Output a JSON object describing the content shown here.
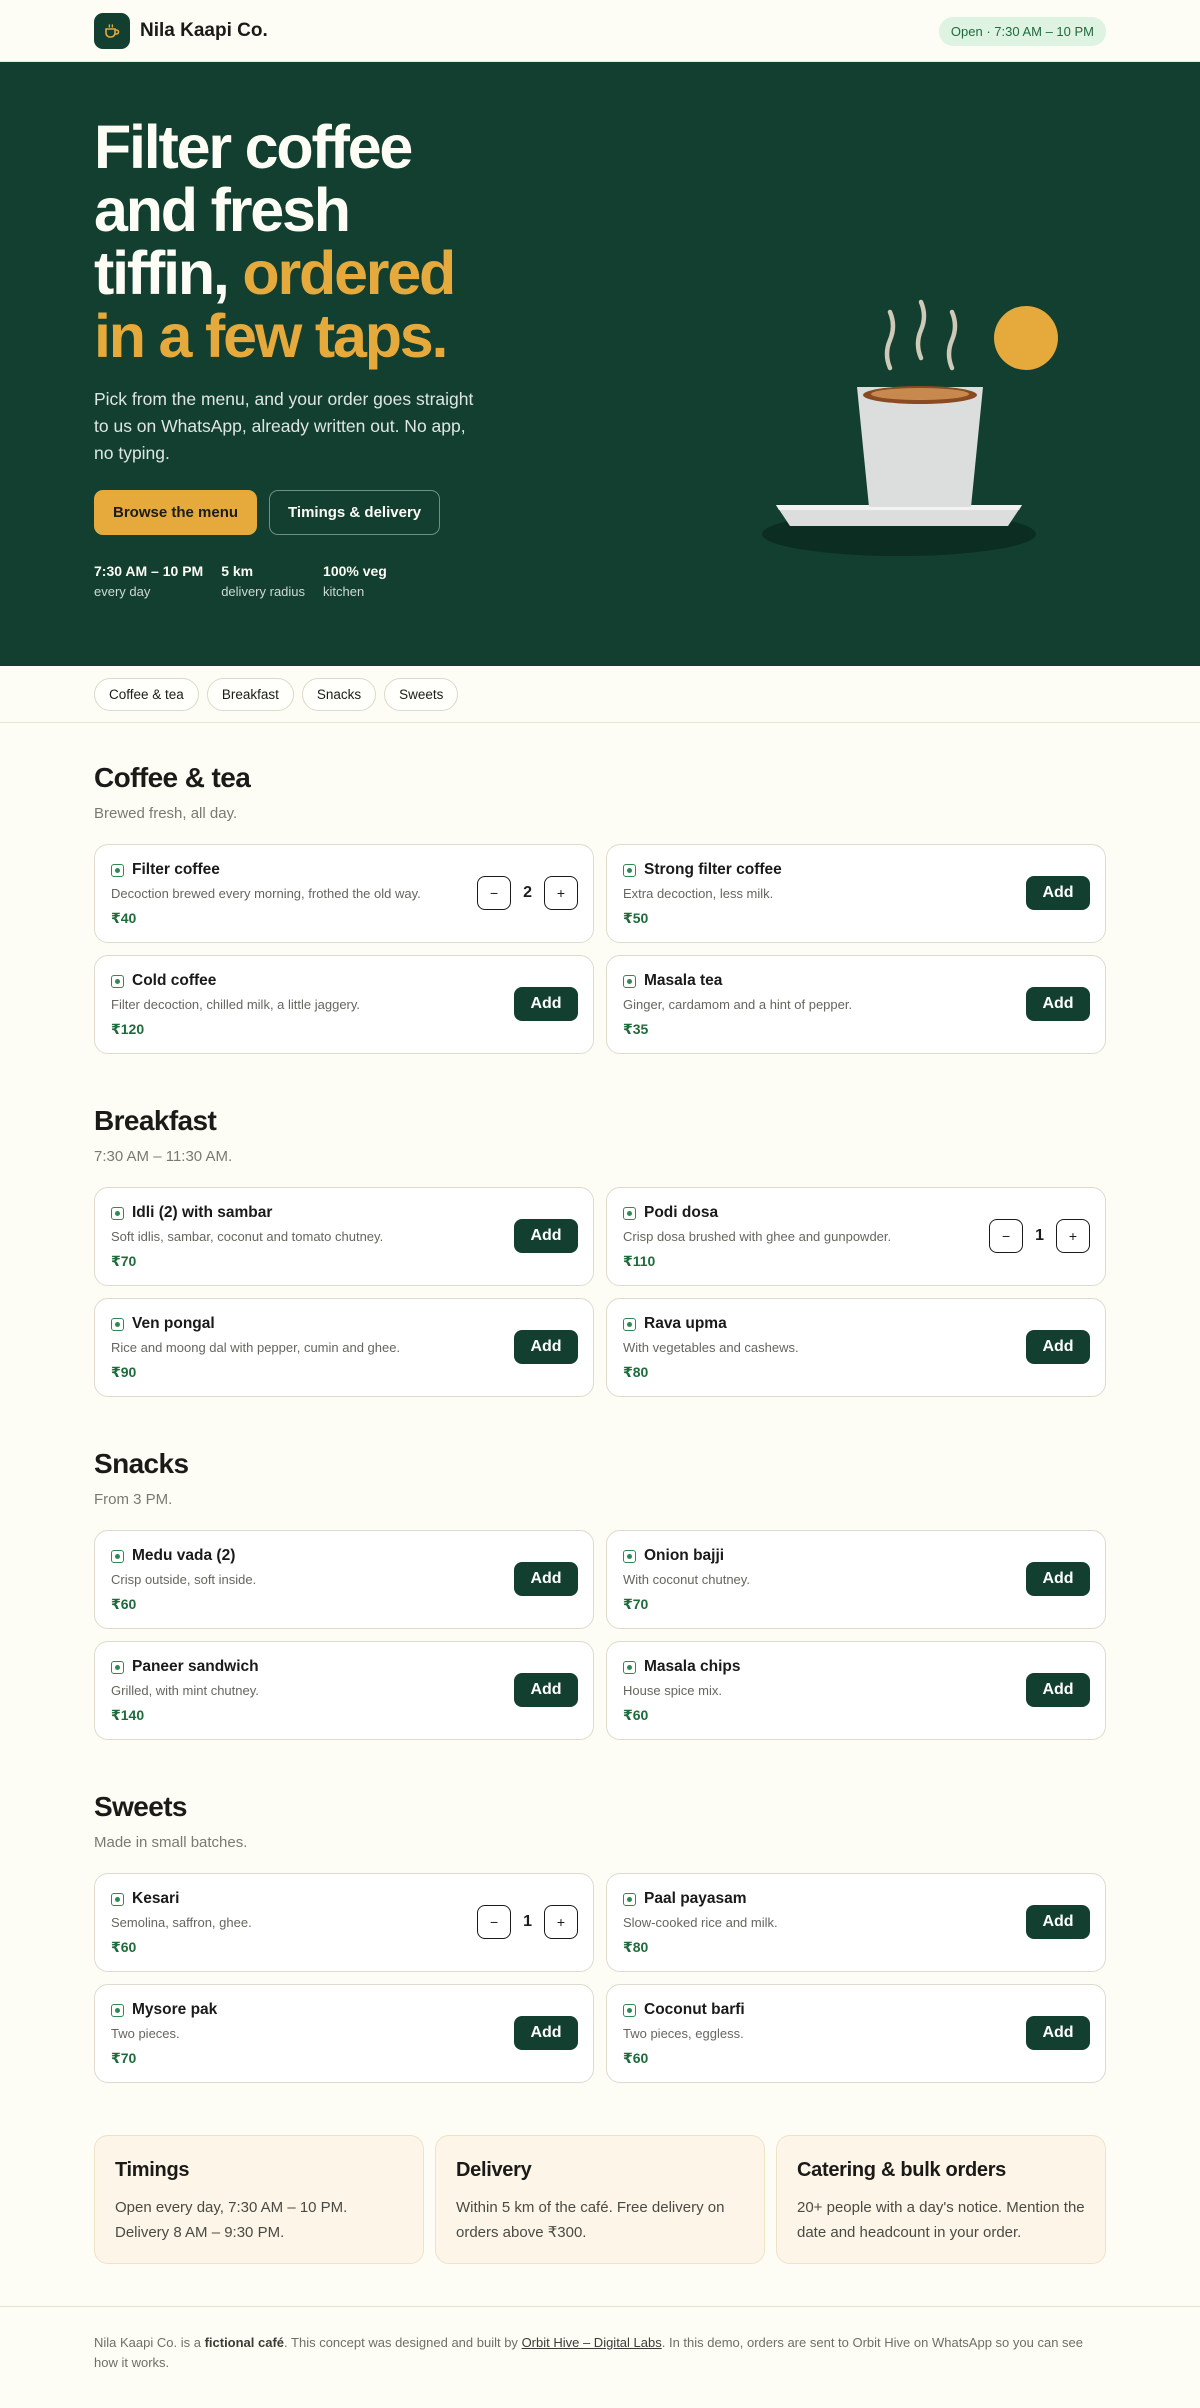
{
  "header": {
    "brand_name": "Nila Kaapi Co.",
    "logo_icon": "coffee-cup-icon",
    "status": "Open · 7:30 AM – 10 PM"
  },
  "hero": {
    "title_line1": "Filter coffee",
    "title_line2": "and fresh",
    "title_line3_plain": "tiffin, ",
    "title_line3_accent": "ordered",
    "title_line4_accent": "in a few taps.",
    "subtitle": "Pick from the menu, and your order goes straight to us on WhatsApp, already written out. No app, no typing.",
    "primary_button": "Browse the menu",
    "secondary_button": "Timings & delivery",
    "stats": [
      {
        "value": "7:30 AM – 10 PM",
        "label": "every day"
      },
      {
        "value": "5 km",
        "label": "delivery radius"
      },
      {
        "value": "100% veg",
        "label": "kitchen"
      }
    ]
  },
  "categories": [
    "Coffee & tea",
    "Breakfast",
    "Snacks",
    "Sweets"
  ],
  "colors": {
    "brand_green": "#123f30",
    "accent_gold": "#e6a93c",
    "price_green": "#1f6b3c"
  },
  "sections": [
    {
      "title": "Coffee & tea",
      "subtitle": "Brewed fresh, all day.",
      "items": [
        {
          "name": "Filter coffee",
          "desc": "Decoction brewed every morning, frothed the old way.",
          "price": "₹40",
          "qty": "2",
          "action": ""
        },
        {
          "name": "Strong filter coffee",
          "desc": "Extra decoction, less milk.",
          "price": "₹50",
          "qty": "",
          "action": "Add"
        },
        {
          "name": "Cold coffee",
          "desc": "Filter decoction, chilled milk, a little jaggery.",
          "price": "₹120",
          "qty": "",
          "action": "Add"
        },
        {
          "name": "Masala tea",
          "desc": "Ginger, cardamom and a hint of pepper.",
          "price": "₹35",
          "qty": "",
          "action": "Add"
        }
      ]
    },
    {
      "title": "Breakfast",
      "subtitle": "7:30 AM – 11:30 AM.",
      "items": [
        {
          "name": "Idli (2) with sambar",
          "desc": "Soft idlis, sambar, coconut and tomato chutney.",
          "price": "₹70",
          "qty": "",
          "action": "Add"
        },
        {
          "name": "Podi dosa",
          "desc": "Crisp dosa brushed with ghee and gunpowder.",
          "price": "₹110",
          "qty": "1",
          "action": ""
        },
        {
          "name": "Ven pongal",
          "desc": "Rice and moong dal with pepper, cumin and ghee.",
          "price": "₹90",
          "qty": "",
          "action": "Add"
        },
        {
          "name": "Rava upma",
          "desc": "With vegetables and cashews.",
          "price": "₹80",
          "qty": "",
          "action": "Add"
        }
      ]
    },
    {
      "title": "Snacks",
      "subtitle": "From 3 PM.",
      "items": [
        {
          "name": "Medu vada (2)",
          "desc": "Crisp outside, soft inside.",
          "price": "₹60",
          "qty": "",
          "action": "Add"
        },
        {
          "name": "Onion bajji",
          "desc": "With coconut chutney.",
          "price": "₹70",
          "qty": "",
          "action": "Add"
        },
        {
          "name": "Paneer sandwich",
          "desc": "Grilled, with mint chutney.",
          "price": "₹140",
          "qty": "",
          "action": "Add"
        },
        {
          "name": "Masala chips",
          "desc": "House spice mix.",
          "price": "₹60",
          "qty": "",
          "action": "Add"
        }
      ]
    },
    {
      "title": "Sweets",
      "subtitle": "Made in small batches.",
      "items": [
        {
          "name": "Kesari",
          "desc": "Semolina, saffron, ghee.",
          "price": "₹60",
          "qty": "1",
          "action": ""
        },
        {
          "name": "Paal payasam",
          "desc": "Slow-cooked rice and milk.",
          "price": "₹80",
          "qty": "",
          "action": "Add"
        },
        {
          "name": "Mysore pak",
          "desc": "Two pieces.",
          "price": "₹70",
          "qty": "",
          "action": "Add"
        },
        {
          "name": "Coconut barfi",
          "desc": "Two pieces, eggless.",
          "price": "₹60",
          "qty": "",
          "action": "Add"
        }
      ]
    }
  ],
  "stepper": {
    "minus": "−",
    "plus": "+"
  },
  "info_cards": [
    {
      "title": "Timings",
      "body": "Open every day, 7:30 AM – 10 PM. Delivery 8 AM – 9:30 PM."
    },
    {
      "title": "Delivery",
      "body": "Within 5 km of the café. Free delivery on orders above ₹300."
    },
    {
      "title": "Catering & bulk orders",
      "body": "20+ people with a day's notice. Mention the date and headcount in your order."
    }
  ],
  "footer": {
    "t1": "Nila Kaapi Co. is a ",
    "bold": "fictional café",
    "t2": ". This concept was designed and built by ",
    "link": "Orbit Hive – Digital Labs",
    "t3": ". In this demo, orders are sent to Orbit Hive on WhatsApp so you can see how it works."
  }
}
